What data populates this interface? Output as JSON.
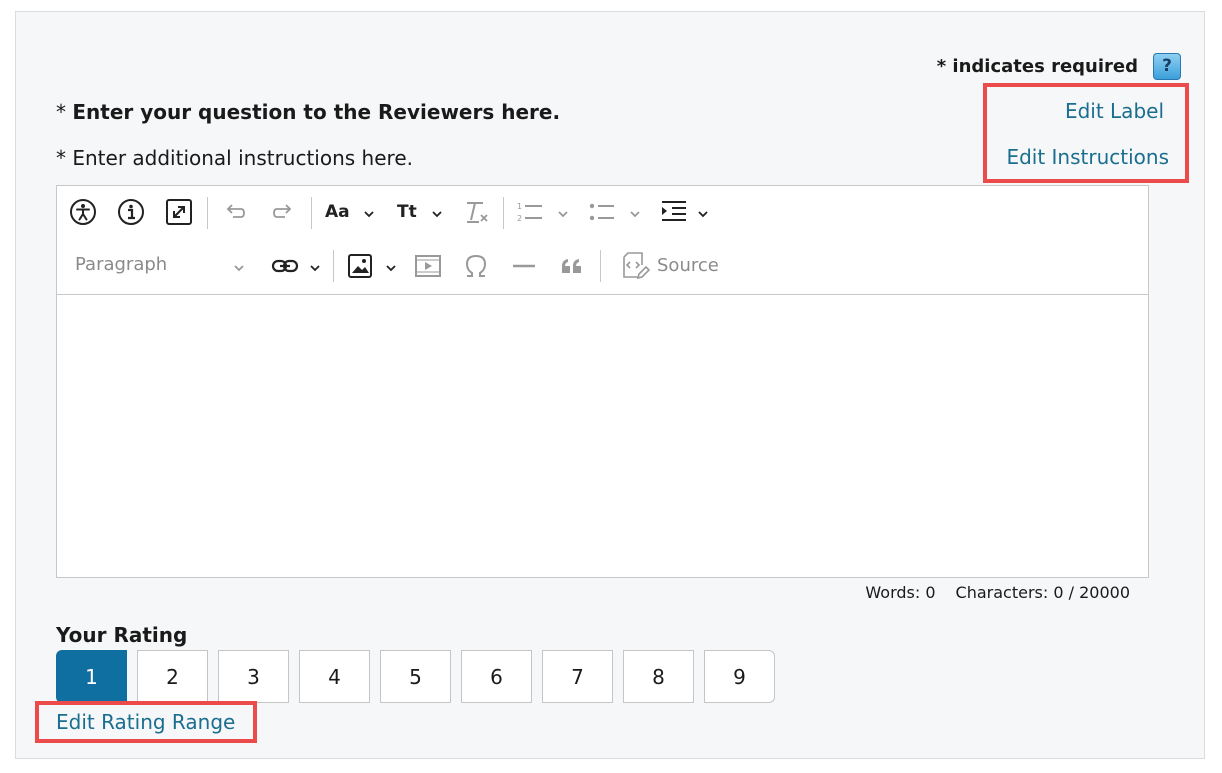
{
  "required_note": "* indicates required",
  "help_label": "?",
  "question_label": {
    "prefix": "* ",
    "text": "Enter your question to the Reviewers here."
  },
  "instructions_label": "* Enter additional instructions here.",
  "links": {
    "edit_label": "Edit Label",
    "edit_instructions": "Edit Instructions",
    "edit_rating_range": "Edit Rating Range"
  },
  "editor": {
    "toolbar_icons": [
      "accessibility-icon",
      "info-icon",
      "fullscreen-icon",
      "undo-icon",
      "redo-icon",
      "font-family-icon",
      "font-size-icon",
      "remove-format-icon",
      "numbered-list-icon",
      "bulleted-list-icon",
      "indent-icon",
      "link-icon",
      "image-icon",
      "media-icon",
      "special-characters-icon",
      "horizontal-line-icon",
      "blockquote-icon",
      "source-icon"
    ],
    "font_family_label": "Aa",
    "font_size_label": "Tt",
    "heading_select": "Paragraph",
    "source_label": "Source",
    "content": ""
  },
  "counts": {
    "words": "Words: 0",
    "characters": "Characters: 0 / 20000"
  },
  "rating": {
    "title": "Your Rating",
    "options": [
      "1",
      "2",
      "3",
      "4",
      "5",
      "6",
      "7",
      "8",
      "9"
    ],
    "selected": "1"
  },
  "colors": {
    "accent": "#0f6fa0",
    "link": "#1a6e8f",
    "highlight": "#ec4b4b"
  }
}
